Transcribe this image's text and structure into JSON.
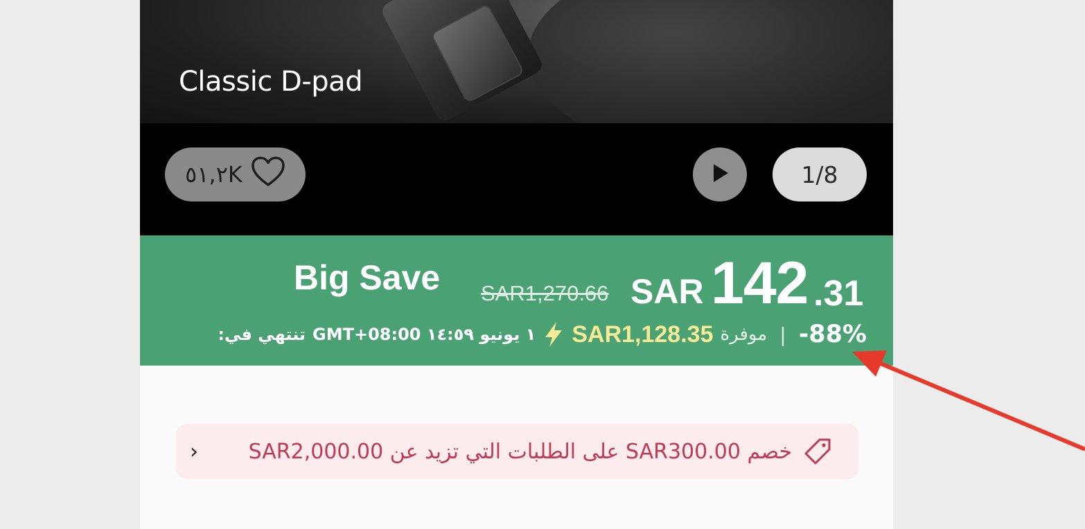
{
  "hero": {
    "caption": "Classic D-pad"
  },
  "media": {
    "like_count": "٥١,٢K",
    "image_counter": "1/8"
  },
  "banner": {
    "label": "Big Save",
    "original_price": "SAR1,270.66",
    "currency": "SAR",
    "price_integer": "142",
    "price_decimal": ".31",
    "discount": "-88%",
    "separator": "|",
    "saved_word": "موفرة",
    "saved_amount": "SAR1,128.35",
    "deadline": "١ يونيو ١٤:٥٩ GMT+08:00",
    "ends_label": "تنتهي في:",
    "background_color": "#4aa173",
    "savings_color": "#f6ec95"
  },
  "coupon": {
    "text": "خصم SAR300.00 على الطلبات التي تزيد عن SAR2,000.00",
    "chevron": "‹",
    "text_color": "#c13a55",
    "background_color": "#fcecee"
  },
  "icons": {
    "like": "heart-icon",
    "play": "play-icon",
    "savings": "lightning-icon",
    "coupon": "tag-icon",
    "annotation": "red-arrow"
  }
}
